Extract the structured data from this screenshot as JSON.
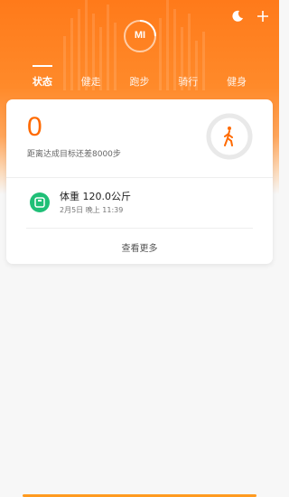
{
  "header": {
    "tabs": [
      {
        "label": "状态",
        "active": true
      },
      {
        "label": "健走"
      },
      {
        "label": "跑步"
      },
      {
        "label": "骑行"
      },
      {
        "label": "健身"
      }
    ],
    "logo_text": "MI",
    "top_icons": [
      "sleep-moon-icon",
      "plus-icon"
    ]
  },
  "card": {
    "steps": "0",
    "steps_hint": "距离达成目标还差8000步",
    "weight_title": "体重 120.0公斤",
    "weight_time": "2月5日 晚上 11:39",
    "more_label": "查看更多"
  },
  "colors": {
    "accent": "#ff6a00",
    "scale_green": "#1fbf77"
  }
}
